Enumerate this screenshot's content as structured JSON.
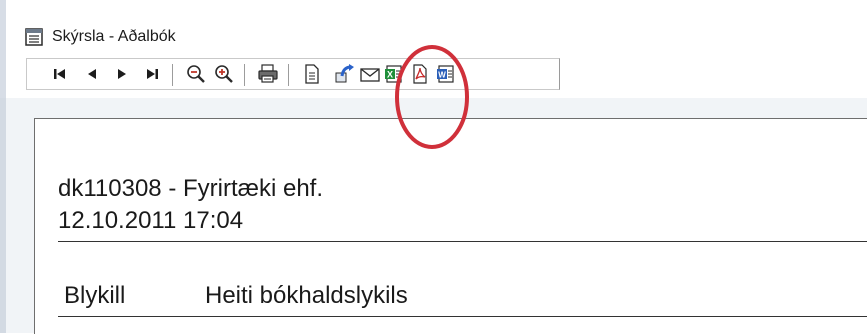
{
  "window": {
    "title": "Skýrsla - Aðalbók"
  },
  "toolbar": {
    "buttons": [
      {
        "name": "first-page-button",
        "icon": "first-page-icon",
        "glyph": "⏮"
      },
      {
        "name": "previous-page-button",
        "icon": "previous-page-icon",
        "glyph": "◀"
      },
      {
        "name": "next-page-button",
        "icon": "next-page-icon",
        "glyph": "▶"
      },
      {
        "name": "last-page-button",
        "icon": "last-page-icon",
        "glyph": "⏭"
      },
      {
        "name": "zoom-out-button",
        "icon": "zoom-out-icon",
        "glyph": "−"
      },
      {
        "name": "zoom-in-button",
        "icon": "zoom-in-icon",
        "glyph": "+"
      },
      {
        "name": "print-button",
        "icon": "printer-icon"
      },
      {
        "name": "page-setup-button",
        "icon": "document-icon"
      },
      {
        "name": "export-button",
        "icon": "export-icon"
      },
      {
        "name": "email-button",
        "icon": "envelope-icon"
      },
      {
        "name": "excel-export-button",
        "icon": "excel-icon"
      },
      {
        "name": "pdf-export-button",
        "icon": "pdf-icon"
      },
      {
        "name": "word-export-button",
        "icon": "word-icon"
      }
    ],
    "highlight_color": "#d0303a"
  },
  "report": {
    "company_line": "dk110308 - Fyrirtæki ehf.",
    "datetime": "12.10.2011 17:04",
    "columns": [
      "Blykill",
      "Heiti bókhaldslykils"
    ]
  }
}
